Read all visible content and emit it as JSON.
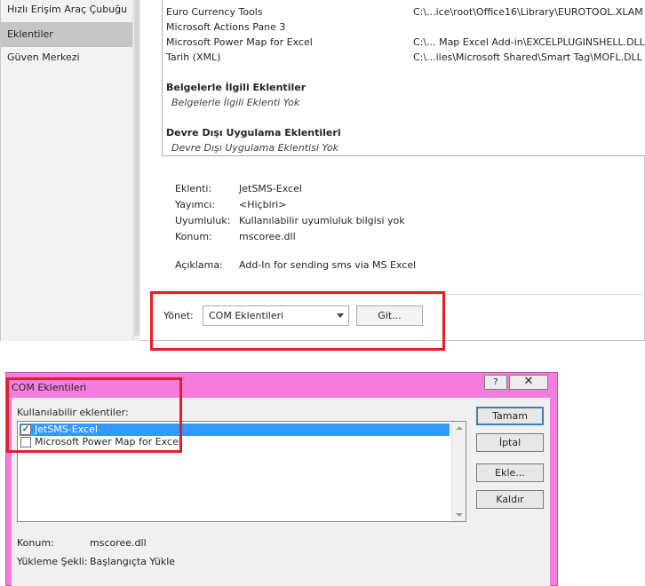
{
  "nav": {
    "items": [
      {
        "label": "Hızlı Erişim Araç Çubuğu",
        "active": false
      },
      {
        "label": "Eklentiler",
        "active": true
      },
      {
        "label": "Güven Merkezi",
        "active": false
      }
    ]
  },
  "addins": {
    "rows": [
      {
        "name": "Euro Currency Tools",
        "path": "C:\\...ice\\root\\Office16\\Library\\EUROTOOL.XLAM"
      },
      {
        "name": "Microsoft Actions Pane 3",
        "path": ""
      },
      {
        "name": "Microsoft Power Map for Excel",
        "path": "C:\\... Map Excel Add-in\\EXCELPLUGINSHELL.DLL"
      },
      {
        "name": "Tarih (XML)",
        "path": "C:\\...iles\\Microsoft Shared\\Smart Tag\\MOFL.DLL"
      }
    ],
    "document_group": {
      "title": "Belgelerle İlgili Eklentiler",
      "empty": "Belgelerle İlgili Eklenti Yok"
    },
    "disabled_group": {
      "title": "Devre Dışı Uygulama Eklentileri",
      "empty": "Devre Dışı Uygulama Eklentisi Yok"
    }
  },
  "details": {
    "addin": {
      "label": "Eklenti:",
      "value": "JetSMS-Excel"
    },
    "publisher": {
      "label": "Yayımcı:",
      "value": "<Hiçbiri>"
    },
    "compatibility": {
      "label": "Uyumluluk:",
      "value": "Kullanılabilir uyumluluk bilgisi yok"
    },
    "location": {
      "label": "Konum:",
      "value": "mscoree.dll"
    },
    "description": {
      "label": "Açıklama:",
      "value": "Add-In for sending sms via MS Excel"
    }
  },
  "manage": {
    "label": "Yönet:",
    "selected": "COM Eklentileri",
    "go_label": "Git..."
  },
  "dialog": {
    "title": "COM Eklentileri",
    "help_label": "?",
    "close_label": "✕",
    "available_label": "Kullanılabilir eklentiler:",
    "items": [
      {
        "label": "JetSMS-Excel",
        "checked": true,
        "selected": true
      },
      {
        "label": "Microsoft Power Map for Excel",
        "checked": false,
        "selected": false
      }
    ],
    "buttons": {
      "ok": "Tamam",
      "cancel": "İptal",
      "add": "Ekle...",
      "remove": "Kaldır"
    },
    "location": {
      "label": "Konum:",
      "value": "mscoree.dll"
    },
    "load_behavior": {
      "label": "Yükleme Şekli:",
      "value": "Başlangıçta Yükle"
    }
  },
  "colors": {
    "highlight": "#e41e2a",
    "dialog_frame": "#f67ddd",
    "selection": "#3399ff"
  }
}
